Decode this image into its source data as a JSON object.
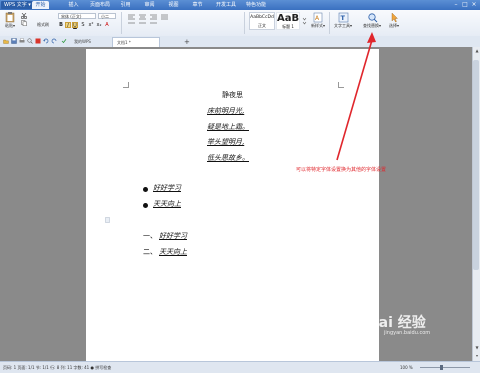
{
  "app": {
    "logo_text": "WPS 文字 ▾"
  },
  "menu": {
    "items": [
      "开始",
      "插入",
      "页面布局",
      "引用",
      "审阅",
      "视图",
      "章节",
      "开发工具",
      "特色功能"
    ],
    "active_index": 0
  },
  "ribbon": {
    "paste_label": "粘贴▾",
    "format_painter_label": "格式刷",
    "font_name": "宋体 (正文)",
    "font_size": "小二",
    "style_preview_1": "AaBbCcDd",
    "style_label_1": "正文",
    "style_preview_2": "AaB",
    "style_label_2": "标题 1",
    "new_style_label": "新样式▾",
    "text_tools_label": "文字工具▾",
    "find_replace_label": "查找替换▾",
    "select_label": "选择▾"
  },
  "tabs": {
    "home_tab": "我的WPS",
    "doc_tab": "文档1 *",
    "add": "+"
  },
  "document": {
    "title": "静夜思",
    "poem_lines": [
      "床前明月光,",
      "疑是地上霜。",
      "举头望明月,",
      "低头思故乡。"
    ],
    "bullet_items": [
      "好好学习",
      "天天向上"
    ],
    "numbered_items": [
      {
        "prefix": "一、",
        "text": "好好学习"
      },
      {
        "prefix": "二、",
        "text": "天天向上"
      }
    ]
  },
  "annotation": {
    "text": "可以将特定字体设置换为其他的字体设置",
    "color": "#e0262c"
  },
  "statusbar": {
    "text": "页码: 1   页面: 1/1   节: 1/1   行: 8   列: 11   字数: 41   ● 拼写检查",
    "zoom": "100 %"
  },
  "watermark": {
    "text": "Bai 经验",
    "sub": "jingyan.baidu.com"
  }
}
